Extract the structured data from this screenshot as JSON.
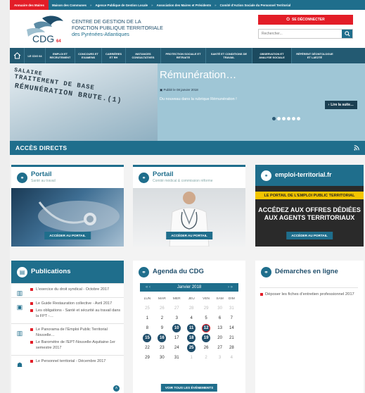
{
  "topbar": {
    "items": [
      "Annuaire des Maires",
      "Maison des Communes",
      "Agence Publique de Gestion Locale",
      "Association des Maires et Présidents",
      "Comité d'Action Sociale du Personnel Territorial"
    ],
    "sep": "»"
  },
  "header": {
    "logo_text": "CDG",
    "logo_num": "64",
    "org_line1": "CENTRE DE GESTION DE LA",
    "org_line2": "FONCTION PUBLIQUE TERRITORIALE",
    "org_line3": "des Pyrénées-Atlantiques",
    "disconnect_label": "SE DÉCONNECTER",
    "search_placeholder": "Rechercher..."
  },
  "nav": {
    "items": [
      "LE CDG 64",
      "EMPLOI ET RECRUTEMENT",
      "CONCOURS ET EXAMENS",
      "CARRIÈRES ET RH",
      "INSTANCES CONSULTATIVES",
      "PROTECTION SOCIALE ET RETRAITE",
      "SANTÉ ET CONDITIONS DE TRAVAIL",
      "OBSERVATION ET ANALYSE SOCIALE",
      "RÉFÉRENT DÉONTOLOGUE ET LAÏCITÉ"
    ]
  },
  "hero": {
    "photo_lines": [
      "SALAIRE",
      "TRAITEMENT DE BASE",
      "RÉMUNÉRATION BRUTE.(1)"
    ],
    "title": "Rémunération…",
    "date": "Publié le 08 janvier 2018",
    "text": "Du nouveau dans la rubrique Rémunération !",
    "button": "Lire la suite…",
    "dots_total": 6,
    "dot_active": 0
  },
  "acces": {
    "title": "ACCÈS DIRECTS"
  },
  "cards": [
    {
      "title": "Portail",
      "sub": "Santé au travail",
      "button": "ACCÉDER AU PORTAIL"
    },
    {
      "title": "Portail",
      "sub": "Comité médical & commission réforme",
      "button": "ACCÉDER AU PORTAIL"
    }
  ],
  "emploi": {
    "brand": "emploi-territorial.fr",
    "band": "LE PORTAIL DE L'EMPLOI PUBLIC TERRITORIAL",
    "big1": "ACCÉDEZ AUX OFFRES DÉDIÉES",
    "big2": "AUX AGENTS TERRITORIAUX",
    "button": "ACCÉDER AU PORTAIL"
  },
  "publications": {
    "title": "Publications",
    "groups": [
      [
        "L'exercice du droit syndical - Octobre 2017"
      ],
      [
        "Le Guide Restauration collective - Avril 2017",
        "Les obligations - Santé et sécurité au travail dans la FPT -…"
      ],
      [
        "Le Panorama de l'Emploi Public Territorial Nouvelle…",
        "Le Baromètre de l'EPT-Nouvelle-Aquitaine-1er semestre 2017"
      ],
      [
        "Le Personnel territorial - Décembre 2017"
      ]
    ]
  },
  "agenda": {
    "title": "Agenda du CDG",
    "month": "Janvier 2018",
    "prev": "«   ‹",
    "next": "›   »",
    "days": [
      "LUN",
      "MAR",
      "MER",
      "JEU",
      "VEN",
      "SAM",
      "DIM"
    ],
    "weeks": [
      [
        "25",
        "26",
        "27",
        "28",
        "29",
        "30",
        "31"
      ],
      [
        "1",
        "2",
        "3",
        "4",
        "5",
        "6",
        "7"
      ],
      [
        "8",
        "9",
        "10",
        "11",
        "12",
        "13",
        "14"
      ],
      [
        "15",
        "16",
        "17",
        "18",
        "19",
        "20",
        "21"
      ],
      [
        "22",
        "23",
        "24",
        "25",
        "26",
        "27",
        "28"
      ],
      [
        "29",
        "30",
        "31",
        "1",
        "2",
        "3",
        "4"
      ]
    ],
    "button": "VOIR TOUS LES ÉVÉNEMENTS"
  },
  "demarches": {
    "title": "Démarches en ligne",
    "items": [
      "Déposer les fiches d'entretien professionnel 2017"
    ]
  }
}
